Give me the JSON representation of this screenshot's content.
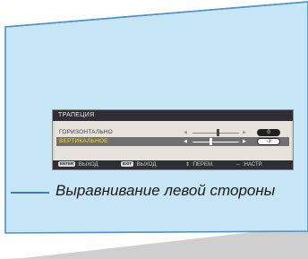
{
  "osd": {
    "title": "ТРАПЕЦИЯ",
    "rows": [
      {
        "label": "ГОРИЗОНТАЛЬНО",
        "value": "0",
        "level": 0.55
      },
      {
        "label": "ВЕРТИКАЛЬНОЕ",
        "value": "-3",
        "level": 0.4
      }
    ],
    "footer": [
      {
        "key": "ENTER",
        "label": ":ВЫХОД"
      },
      {
        "key": "EXIT",
        "label": ":ВЫХОД"
      },
      {
        "glyph": "⇕",
        "label": ":ПЕРЕМ."
      },
      {
        "glyph": "⇔",
        "label": ":НАСТР."
      }
    ]
  },
  "callout": {
    "text": "Выравнивание левой стороны"
  },
  "icons": {
    "left_arrow": "left-arrow-icon",
    "right_arrow": "right-arrow-icon",
    "updown": "updown-arrows-icon",
    "leftright": "leftright-arrows-icon"
  },
  "colors": {
    "screen": "#c6e6f6",
    "screen_border": "#4f91cc",
    "floor": "#cfcfcf",
    "highlight_text": "#ffe000",
    "callout_line": "#3a7bbf"
  }
}
